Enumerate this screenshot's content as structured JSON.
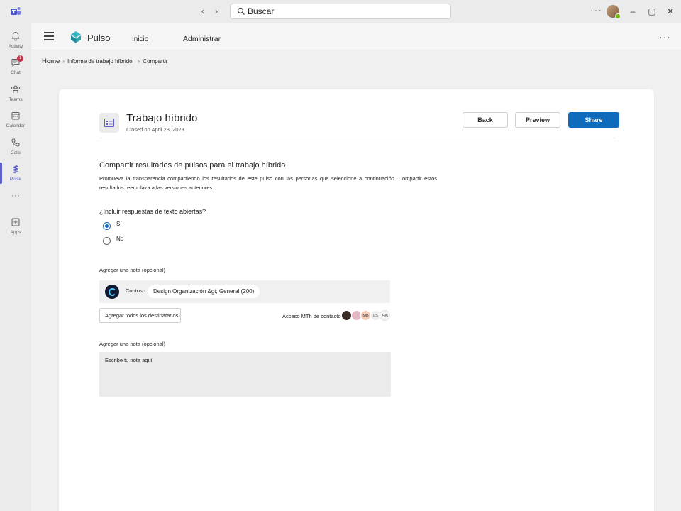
{
  "titlebar": {
    "search_placeholder": "Buscar",
    "more_label": "···",
    "minimize": "–",
    "maximize": "▢",
    "close": "✕"
  },
  "rail": {
    "items": [
      {
        "label": "Activity",
        "icon": "bell-icon"
      },
      {
        "label": "Chat",
        "icon": "chat-icon",
        "badge": "1"
      },
      {
        "label": "Teams",
        "icon": "teams-icon"
      },
      {
        "label": "Calendar",
        "icon": "calendar-icon"
      },
      {
        "label": "Calls",
        "icon": "phone-icon"
      },
      {
        "label": "Pulse",
        "icon": "pulse-icon",
        "active": true
      },
      {
        "label": "···",
        "icon": "more-icon"
      },
      {
        "label": "Apps",
        "icon": "apps-icon"
      }
    ]
  },
  "header": {
    "app_name": "Pulso",
    "tabs": [
      "Inicio",
      "Administrar"
    ],
    "more": "···"
  },
  "breadcrumb": {
    "home": "Home",
    "report": "Informe de trabajo híbrido",
    "current": "Compartir"
  },
  "page": {
    "title": "Trabajo híbrido",
    "subtitle": "Closed on April 23, 2023",
    "buttons": {
      "back": "Back",
      "preview": "Preview",
      "share": "Share"
    }
  },
  "share_section": {
    "title": "Compartir resultados de pulsos para el trabajo híbrido",
    "description": "Promueva la transparencia compartiendo los resultados de este pulso con las personas que seleccione a continuación. Compartir estos resultados reemplaza a las versiones anteriores.",
    "question": "¿Incluir respuestas de texto abiertas?",
    "options": [
      {
        "label": "Sí",
        "checked": true
      },
      {
        "label": "No",
        "checked": false
      }
    ]
  },
  "recipients": {
    "label": "Agregar una nota (opcional)",
    "org_name": "Contoso",
    "chip": "Design Organización &gt; General (200)",
    "add_all_button": "Agregar todos los destinatarios de Pulse",
    "access_label": "Acceso MTh de contacto",
    "avatars": [
      "",
      "",
      "MB",
      "LS",
      "+96"
    ]
  },
  "note": {
    "label": "Agregar una nota (opcional)",
    "placeholder": "Escribe tu nota aquí"
  },
  "colors": {
    "accent": "#5b5fc7",
    "primary_button": "#0f6cbd",
    "badge": "#c4314b"
  }
}
